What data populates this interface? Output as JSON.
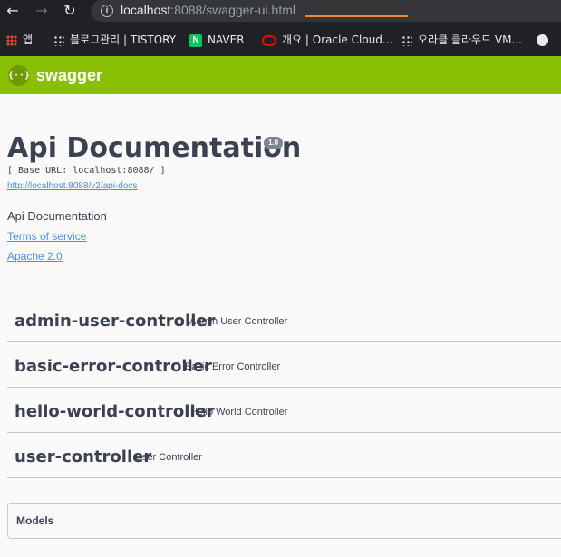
{
  "browser": {
    "url_host": "localhost",
    "url_rest": ":8088/swagger-ui.html",
    "url_path_highlight": "swagger-ui.html",
    "back_icon": "arrow-left-icon",
    "forward_icon": "arrow-right-icon",
    "reload_icon": "reload-icon",
    "bookmarks": [
      {
        "label": "앱",
        "icon": "apps-grid-icon"
      },
      {
        "label": "블로그관리 | TISTORY",
        "icon": "tistory-icon"
      },
      {
        "label": "NAVER",
        "icon": "naver-icon"
      },
      {
        "label": "개요 | Oracle Cloud...",
        "icon": "oracle-icon"
      },
      {
        "label": "오라클 클라우드 VM...",
        "icon": "tistory-icon"
      },
      {
        "label": "",
        "icon": "globe-icon"
      }
    ]
  },
  "topbar": {
    "logo_symbol": "{··}",
    "logo_text": "swagger",
    "color": "#89bf04"
  },
  "info": {
    "title": "Api Documentation",
    "version": "1.0",
    "base_url": "[ Base URL: localhost:8088/ ]",
    "docs_link": "http://localhost:8088/v2/api-docs",
    "description": "Api Documentation",
    "terms": "Terms of service",
    "license": "Apache 2.0"
  },
  "controllers": [
    {
      "name": "admin-user-controller",
      "description": "Admin User Controller"
    },
    {
      "name": "basic-error-controller",
      "description": "Basic Error Controller"
    },
    {
      "name": "hello-world-controller",
      "description": "Hello World Controller"
    },
    {
      "name": "user-controller",
      "description": "User Controller"
    }
  ],
  "models": {
    "label": "Models"
  },
  "colors": {
    "link": "#4990e2",
    "text": "#3b4151",
    "chrome": "#202124"
  }
}
